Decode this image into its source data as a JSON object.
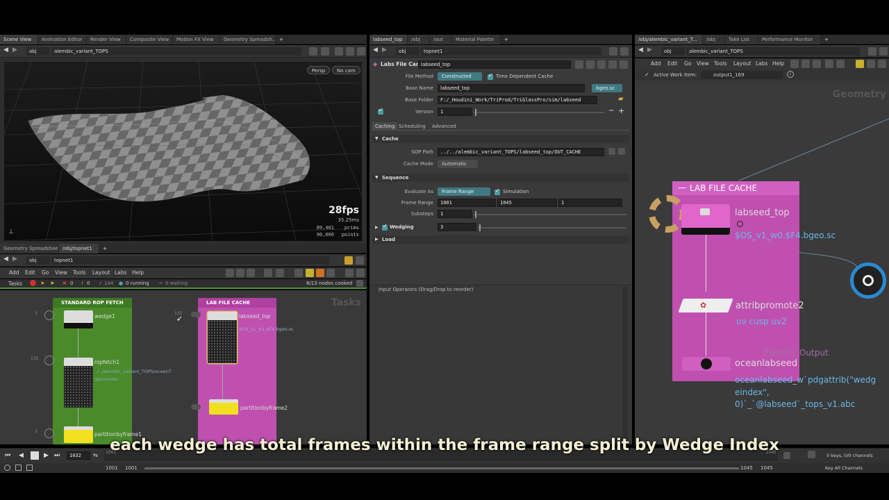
{
  "left_top_tabs": [
    "Scene View",
    "Animation Editor",
    "Render View",
    "Composite View",
    "Motion FX View",
    "Geometry Spreadsh..."
  ],
  "left_top_path": {
    "root": "obj",
    "node": "alembic_variant_TOPS"
  },
  "viewport": {
    "camera": "Persp",
    "cam": "No cam",
    "fps": "28fps",
    "frame_time": "35.25ms",
    "prims_value": "89,401",
    "prims_label": "prims",
    "points_value": "90,000",
    "points_label": "points"
  },
  "left_bottom_tabs": [
    "Geometry Spreadsheet",
    "/obj/topnet1"
  ],
  "left_bottom_path": {
    "root": "obj",
    "node": "topnet1"
  },
  "tops_menu": [
    "Add",
    "Edit",
    "Go",
    "View",
    "Tools",
    "Layout",
    "Labs",
    "Help"
  ],
  "tasks_bar": {
    "label": "Tasks",
    "errors": "0",
    "warnings": "0",
    "count": "144",
    "running": "0 running",
    "waiting": "0 waiting",
    "cooked": "8/13 nodes cooked"
  },
  "network_watermark": "Tasks",
  "network": {
    "rop_fetch_box": "STANDARD ROP FETCH",
    "lab_cache_box": "LAB FILE CACHE",
    "wedge_node": "wedge1",
    "ropfetch_node": "ropfetch1",
    "ropfetch_path": "../../alembic_variant_TOPS/oceanT ops/render",
    "partition1_node": "partitionbyframe1",
    "labseed_node": "labseed_top",
    "labseed_path": "$OS_v1_w1.$F4.bgeo.sc",
    "partition2_node": "partitionbyframe2",
    "counts": [
      "3",
      "135",
      "3",
      "135"
    ]
  },
  "mid_tabs": [
    "labseed_top",
    "/obj",
    "/out",
    "Material Palette"
  ],
  "mid_path": {
    "root": "obj",
    "node": "topnet1"
  },
  "params": {
    "node_type": "Labs File Cache",
    "node_name": "labseed_top",
    "file_method_label": "File Method",
    "file_method": "Constructed",
    "time_dependent_label": "Time Dependent Cache",
    "base_name_label": "Base Name",
    "base_name": "labseed_top",
    "ext": "bgeo.sc",
    "base_folder_label": "Base Folder",
    "base_folder": "F:/_Houdini_Work/TriProd/TriGlassPro/sim/labseed",
    "version_label": "Version",
    "version": "1",
    "tabs": [
      "Caching",
      "Scheduling",
      "Advanced"
    ],
    "cache_section": "Cache",
    "sop_path_label": "SOP Path",
    "sop_path": "../../alembic_variant_TOPS/labseed_top/OUT_CACHE",
    "cache_mode_label": "Cache Mode",
    "cache_mode": "Automatic",
    "sequence_section": "Sequence",
    "evaluate_as_label": "Evaluate As",
    "evaluate_as": "Frame Range",
    "simulation_label": "Simulation",
    "frame_range_label": "Frame Range",
    "frame_start": "1001",
    "frame_end": "1045",
    "frame_inc": "1",
    "substeps_label": "Substeps",
    "substeps": "1",
    "wedging_label": "Wedging",
    "wedging": "3",
    "load_section": "Load",
    "input_operators": "Input Operators (Drag/Drop to reorder)"
  },
  "right_tabs": [
    "/obj/alembic_variant_T...",
    "/obj",
    "Take List",
    "Performance Monitor"
  ],
  "right_path": {
    "root": "obj",
    "node": "alembic_variant_TOPS"
  },
  "right_menu": [
    "Add",
    "Edit",
    "Go",
    "View",
    "Tools",
    "Layout",
    "Labs",
    "Help"
  ],
  "work_item": {
    "label": "Active Work Item:",
    "value": "output1_169"
  },
  "sop_network": {
    "watermark": "Geometry",
    "box_title": "LAB FILE CACHE",
    "labseed_node": "labseed_top",
    "labseed_path": "$OS_v1_w0.$F4.bgeo.sc",
    "attrib_node": "attribpromote2",
    "attrib_sub": "uv cusp uv2",
    "faded_label": "Alembic Output",
    "ocean_node": "oceanlabseed",
    "ocean_path_1": "oceanlabseed_w`pdgattrib(\"wedg",
    "ocean_path_2": "eindex\",",
    "ocean_path_3": "0)`_`@labseed`_tops_v1.abc"
  },
  "timeline": {
    "current_frame": "1032",
    "start": "1001",
    "start2": "1001",
    "end": "1045",
    "end2": "1045",
    "keys": "0 keys, 0/0 channels",
    "key_all": "Key All Channels",
    "ticks": [
      "1001",
      "1045"
    ]
  },
  "subtitle": "each wedge has total frames within the frame range split by Wedge Index",
  "colors": {
    "rop_green": "#4a8a2a",
    "lab_pink": "#c050b0",
    "teal": "#3f7a82",
    "yellow": "#f0e020"
  }
}
